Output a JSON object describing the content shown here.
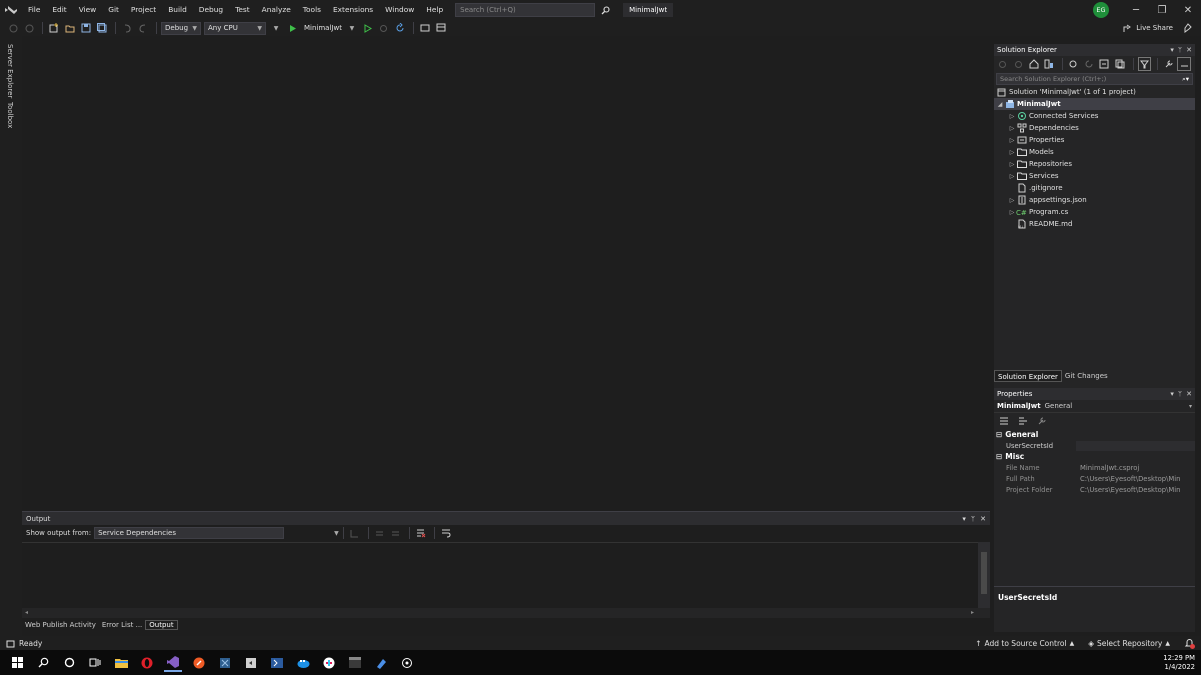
{
  "menu": {
    "items": [
      "File",
      "Edit",
      "View",
      "Git",
      "Project",
      "Build",
      "Debug",
      "Test",
      "Analyze",
      "Tools",
      "Extensions",
      "Window",
      "Help"
    ],
    "search_placeholder": "Search (Ctrl+Q)",
    "solution_name": "MinimalJwt",
    "avatar_initials": "EG"
  },
  "toolbar": {
    "config": "Debug",
    "platform": "Any CPU",
    "run_target": "MinimalJwt",
    "live_share": "Live Share"
  },
  "left_tabs": [
    "Server Explorer",
    "Toolbox"
  ],
  "output": {
    "title": "Output",
    "show_from_label": "Show output from:",
    "source": "Service Dependencies",
    "tabs": [
      "Web Publish Activity",
      "Error List ...",
      "Output"
    ],
    "active_tab": "Output"
  },
  "solution_explorer": {
    "title": "Solution Explorer",
    "search_placeholder": "Search Solution Explorer (Ctrl+;)",
    "solution_label": "Solution 'MinimalJwt' (1 of 1 project)",
    "project": "MinimalJwt",
    "items": [
      {
        "label": "Connected Services",
        "icon": "connected-services-icon",
        "expandable": true
      },
      {
        "label": "Dependencies",
        "icon": "dependencies-icon",
        "expandable": true
      },
      {
        "label": "Properties",
        "icon": "properties-icon",
        "expandable": true
      },
      {
        "label": "Models",
        "icon": "folder-icon",
        "expandable": true
      },
      {
        "label": "Repositories",
        "icon": "folder-icon",
        "expandable": true
      },
      {
        "label": "Services",
        "icon": "folder-icon",
        "expandable": true
      },
      {
        "label": ".gitignore",
        "icon": "file-icon",
        "expandable": false
      },
      {
        "label": "appsettings.json",
        "icon": "json-file-icon",
        "expandable": true
      },
      {
        "label": "Program.cs",
        "icon": "csharp-file-icon",
        "expandable": true
      },
      {
        "label": "README.md",
        "icon": "markdown-file-icon",
        "expandable": false
      }
    ],
    "tabs": [
      "Solution Explorer",
      "Git Changes"
    ]
  },
  "properties": {
    "title": "Properties",
    "object_name": "MinimalJwt",
    "object_type": "General",
    "general_label": "General",
    "user_secrets_label": "UserSecretsId",
    "misc_label": "Misc",
    "file_name_label": "File Name",
    "file_name_value": "MinimalJwt.csproj",
    "full_path_label": "Full Path",
    "full_path_value": "C:\\Users\\Eyesoft\\Desktop\\Min",
    "project_folder_label": "Project Folder",
    "project_folder_value": "C:\\Users\\Eyesoft\\Desktop\\Min",
    "desc_title": "UserSecretsId"
  },
  "status": {
    "ready": "Ready",
    "add_source": "Add to Source Control",
    "select_repo": "Select Repository"
  },
  "clock": {
    "time": "12:29 PM",
    "date": "1/4/2022"
  },
  "colors": {
    "accent_green": "#1f8f3a",
    "vs_purple": "#865fc5"
  }
}
